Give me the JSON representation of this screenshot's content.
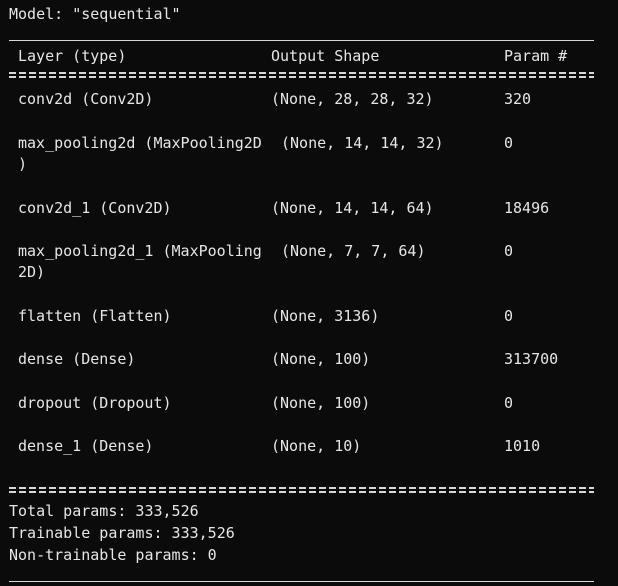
{
  "model_line": "Model: \"sequential\"",
  "header": {
    "layer": "Layer (type)",
    "output_shape": "Output Shape",
    "param": "Param #"
  },
  "rows": [
    {
      "name_line1": "conv2d (Conv2D)",
      "name_line2": "",
      "shape": "(None, 28, 28, 32)",
      "params": "320"
    },
    {
      "name_line1": "max_pooling2d (MaxPooling2D",
      "name_line2": ")",
      "shape": "(None, 14, 14, 32)",
      "params": "0"
    },
    {
      "name_line1": "conv2d_1 (Conv2D)",
      "name_line2": "",
      "shape": "(None, 14, 14, 64)",
      "params": "18496"
    },
    {
      "name_line1": "max_pooling2d_1 (MaxPooling",
      "name_line2": "2D)",
      "shape": "(None, 7, 7, 64)",
      "params": "0"
    },
    {
      "name_line1": "flatten (Flatten)",
      "name_line2": "",
      "shape": "(None, 3136)",
      "params": "0"
    },
    {
      "name_line1": "dense (Dense)",
      "name_line2": "",
      "shape": "(None, 100)",
      "params": "313700"
    },
    {
      "name_line1": "dropout (Dropout)",
      "name_line2": "",
      "shape": "(None, 100)",
      "params": "0"
    },
    {
      "name_line1": "dense_1 (Dense)",
      "name_line2": "",
      "shape": "(None, 10)",
      "params": "1010"
    }
  ],
  "totals": {
    "total": "Total params: 333,526",
    "trainable": "Trainable params: 333,526",
    "non_trainable": "Non-trainable params: 0"
  }
}
